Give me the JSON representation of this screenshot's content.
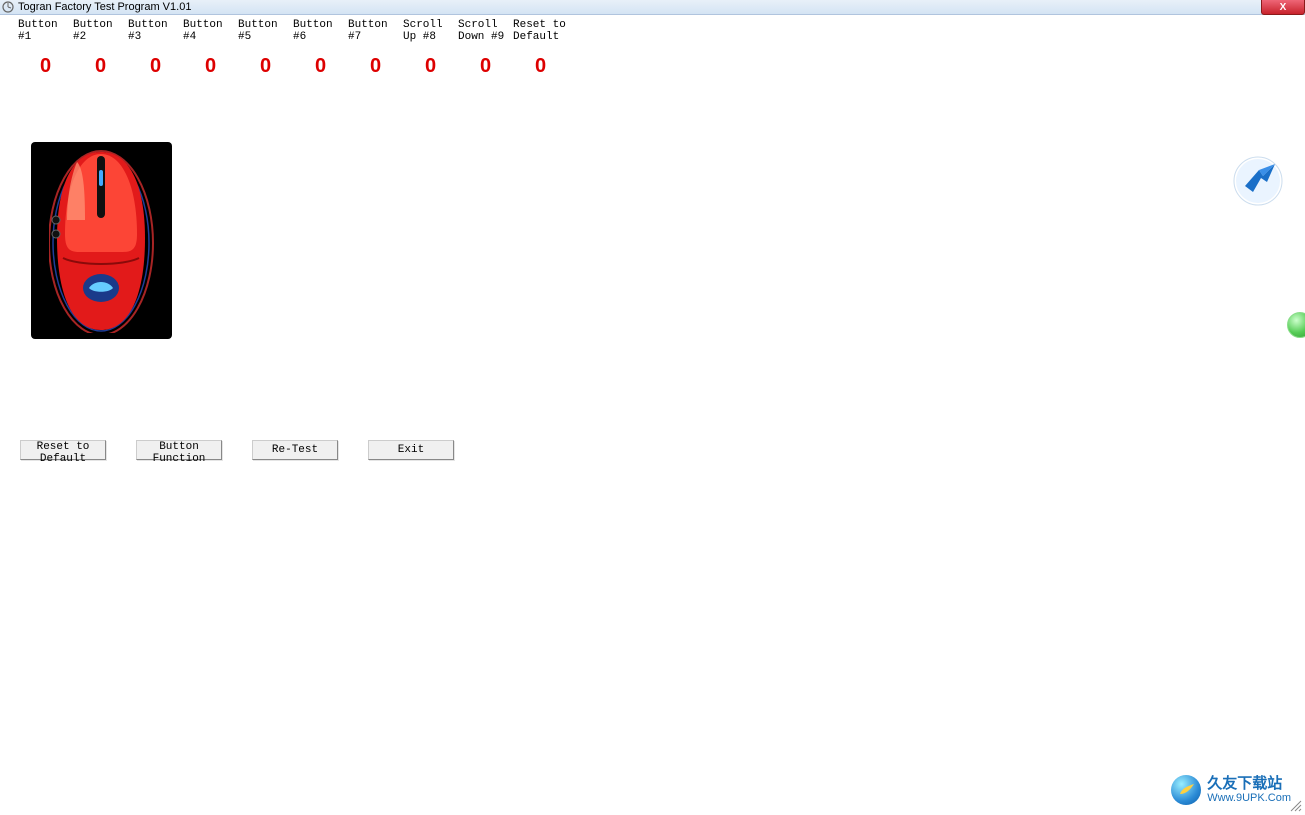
{
  "window": {
    "title": "Togran Factory Test Program V1.01",
    "close_label": "X"
  },
  "columns": [
    {
      "label": "Button #1",
      "count": 0
    },
    {
      "label": "Button #2",
      "count": 0
    },
    {
      "label": "Button #3",
      "count": 0
    },
    {
      "label": "Button #4",
      "count": 0
    },
    {
      "label": "Button #5",
      "count": 0
    },
    {
      "label": "Button #6",
      "count": 0
    },
    {
      "label": "Button #7",
      "count": 0
    },
    {
      "label": "Scroll Up #8",
      "count": 0
    },
    {
      "label": "Scroll Down #9",
      "count": 0
    },
    {
      "label": "Reset to Default",
      "count": 0
    }
  ],
  "buttons": {
    "reset": "Reset to Default",
    "func": "Button Function",
    "retest": "Re-Test",
    "exit": "Exit"
  },
  "watermark": {
    "line1": "久友下载站",
    "line2": "Www.9UPK.Com"
  }
}
